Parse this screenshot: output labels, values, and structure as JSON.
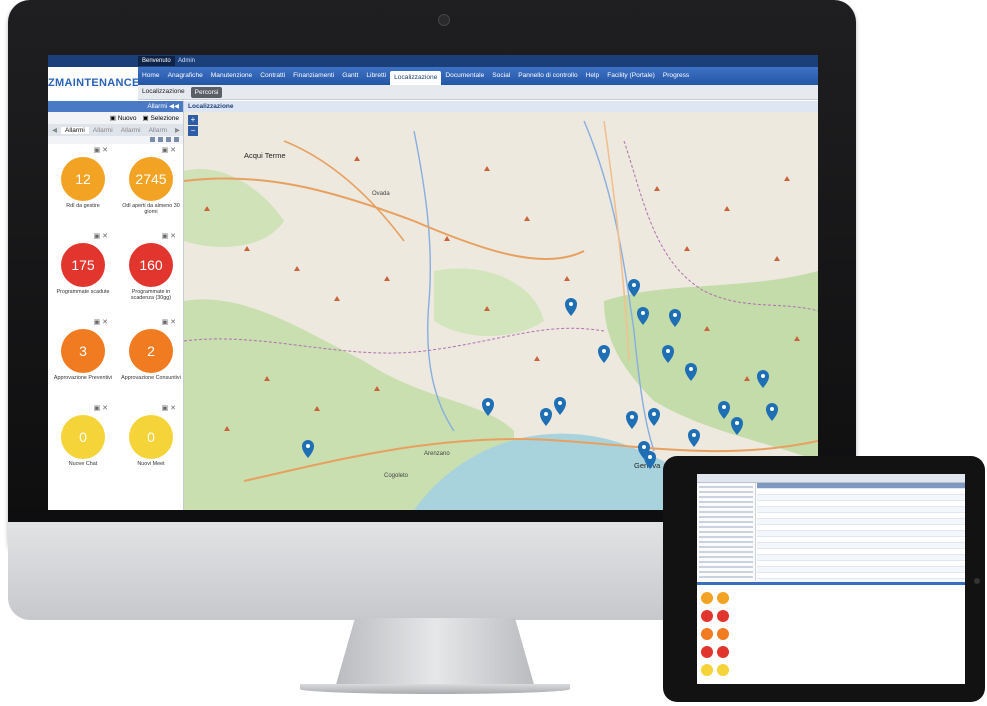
{
  "app": {
    "welcome": "Benvenuto",
    "user": "Admin",
    "logo": "ZMAINTENANCE"
  },
  "menu": [
    "Home",
    "Anagrafiche",
    "Manutenzione",
    "Contratti",
    "Finanziamenti",
    "Gantt",
    "Libretti",
    "Localizzazione",
    "Documentale",
    "Social",
    "Pannello di controllo",
    "Help",
    "Facility (Portale)",
    "Progress"
  ],
  "menu_active": "Localizzazione",
  "subtabs": [
    "Localizzazione",
    "Percorsi"
  ],
  "sidebar": {
    "header": "Allarmi",
    "new_label": "Nuovo",
    "select_label": "Selezione",
    "tabs": [
      "Allarmi",
      "Allarmi",
      "Allarmi",
      "Allarm"
    ]
  },
  "widgets": [
    {
      "value": "12",
      "label": "RdI da gestire",
      "color": "#f3a323"
    },
    {
      "value": "2745",
      "label": "Odl aperti da almeno 30 giorni",
      "color": "#f3a323"
    },
    {
      "value": "175",
      "label": "Programmate scadute",
      "color": "#e2352e"
    },
    {
      "value": "160",
      "label": "Programmate in scadenza (30gg)",
      "color": "#e2352e"
    },
    {
      "value": "3",
      "label": "Approvazione Preventivi",
      "color": "#f07b21"
    },
    {
      "value": "2",
      "label": "Approvazione Consuntivi",
      "color": "#f07b21"
    },
    {
      "value": "0",
      "label": "Nuove Chat",
      "color": "#f5d43a"
    },
    {
      "value": "0",
      "label": "Nuovi Meet",
      "color": "#f5d43a"
    }
  ],
  "map": {
    "title": "Localizzazione",
    "zoom_in": "+",
    "zoom_out": "−",
    "places": [
      "Acqui Terme",
      "Ovada",
      "Arenzano",
      "Cogoleto",
      "Genova"
    ],
    "pin_color": "#1f6fb5"
  }
}
